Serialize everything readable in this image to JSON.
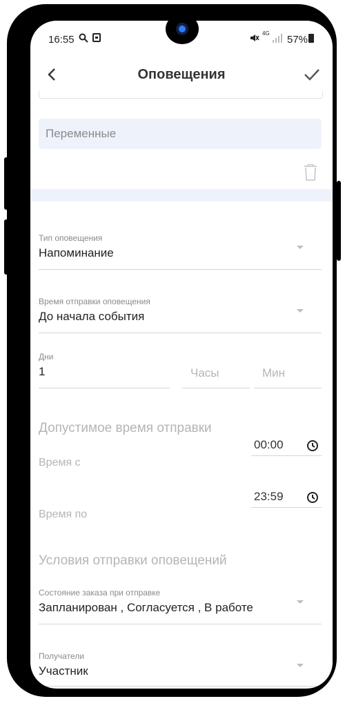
{
  "status_bar": {
    "time": "16:55",
    "battery": "57%",
    "network": "4G"
  },
  "header": {
    "title": "Оповещения"
  },
  "variables_input": {
    "placeholder": "Переменные"
  },
  "notification_type": {
    "label": "Тип оповещения",
    "value": "Напоминание"
  },
  "send_time": {
    "label": "Время отправки оповещения",
    "value": "До начала события"
  },
  "offset": {
    "days_label": "Дни",
    "days_value": "1",
    "hours_placeholder": "Часы",
    "minutes_placeholder": "Мин"
  },
  "allowed_time": {
    "section_title": "Допустимое время отправки",
    "from_label": "Время с",
    "from_value": "00:00",
    "to_label": "Время по",
    "to_value": "23:59"
  },
  "conditions": {
    "section_title": "Условия отправки оповещений",
    "order_state_label": "Состояние заказа при отправке",
    "order_state_value": "Запланирован , Согласуется , В работе",
    "recipients_label": "Получатели",
    "recipients_value": "Участник"
  },
  "icons": [
    "search-icon",
    "gallery-icon",
    "mute-icon",
    "signal-icon",
    "battery-icon",
    "back-arrow-icon",
    "check-icon",
    "trash-icon",
    "clock-icon",
    "dropdown-arrow-icon"
  ],
  "colors": {
    "input_background": "#eef3fb",
    "text_primary": "#222222",
    "text_hint": "#b5b5b5"
  }
}
